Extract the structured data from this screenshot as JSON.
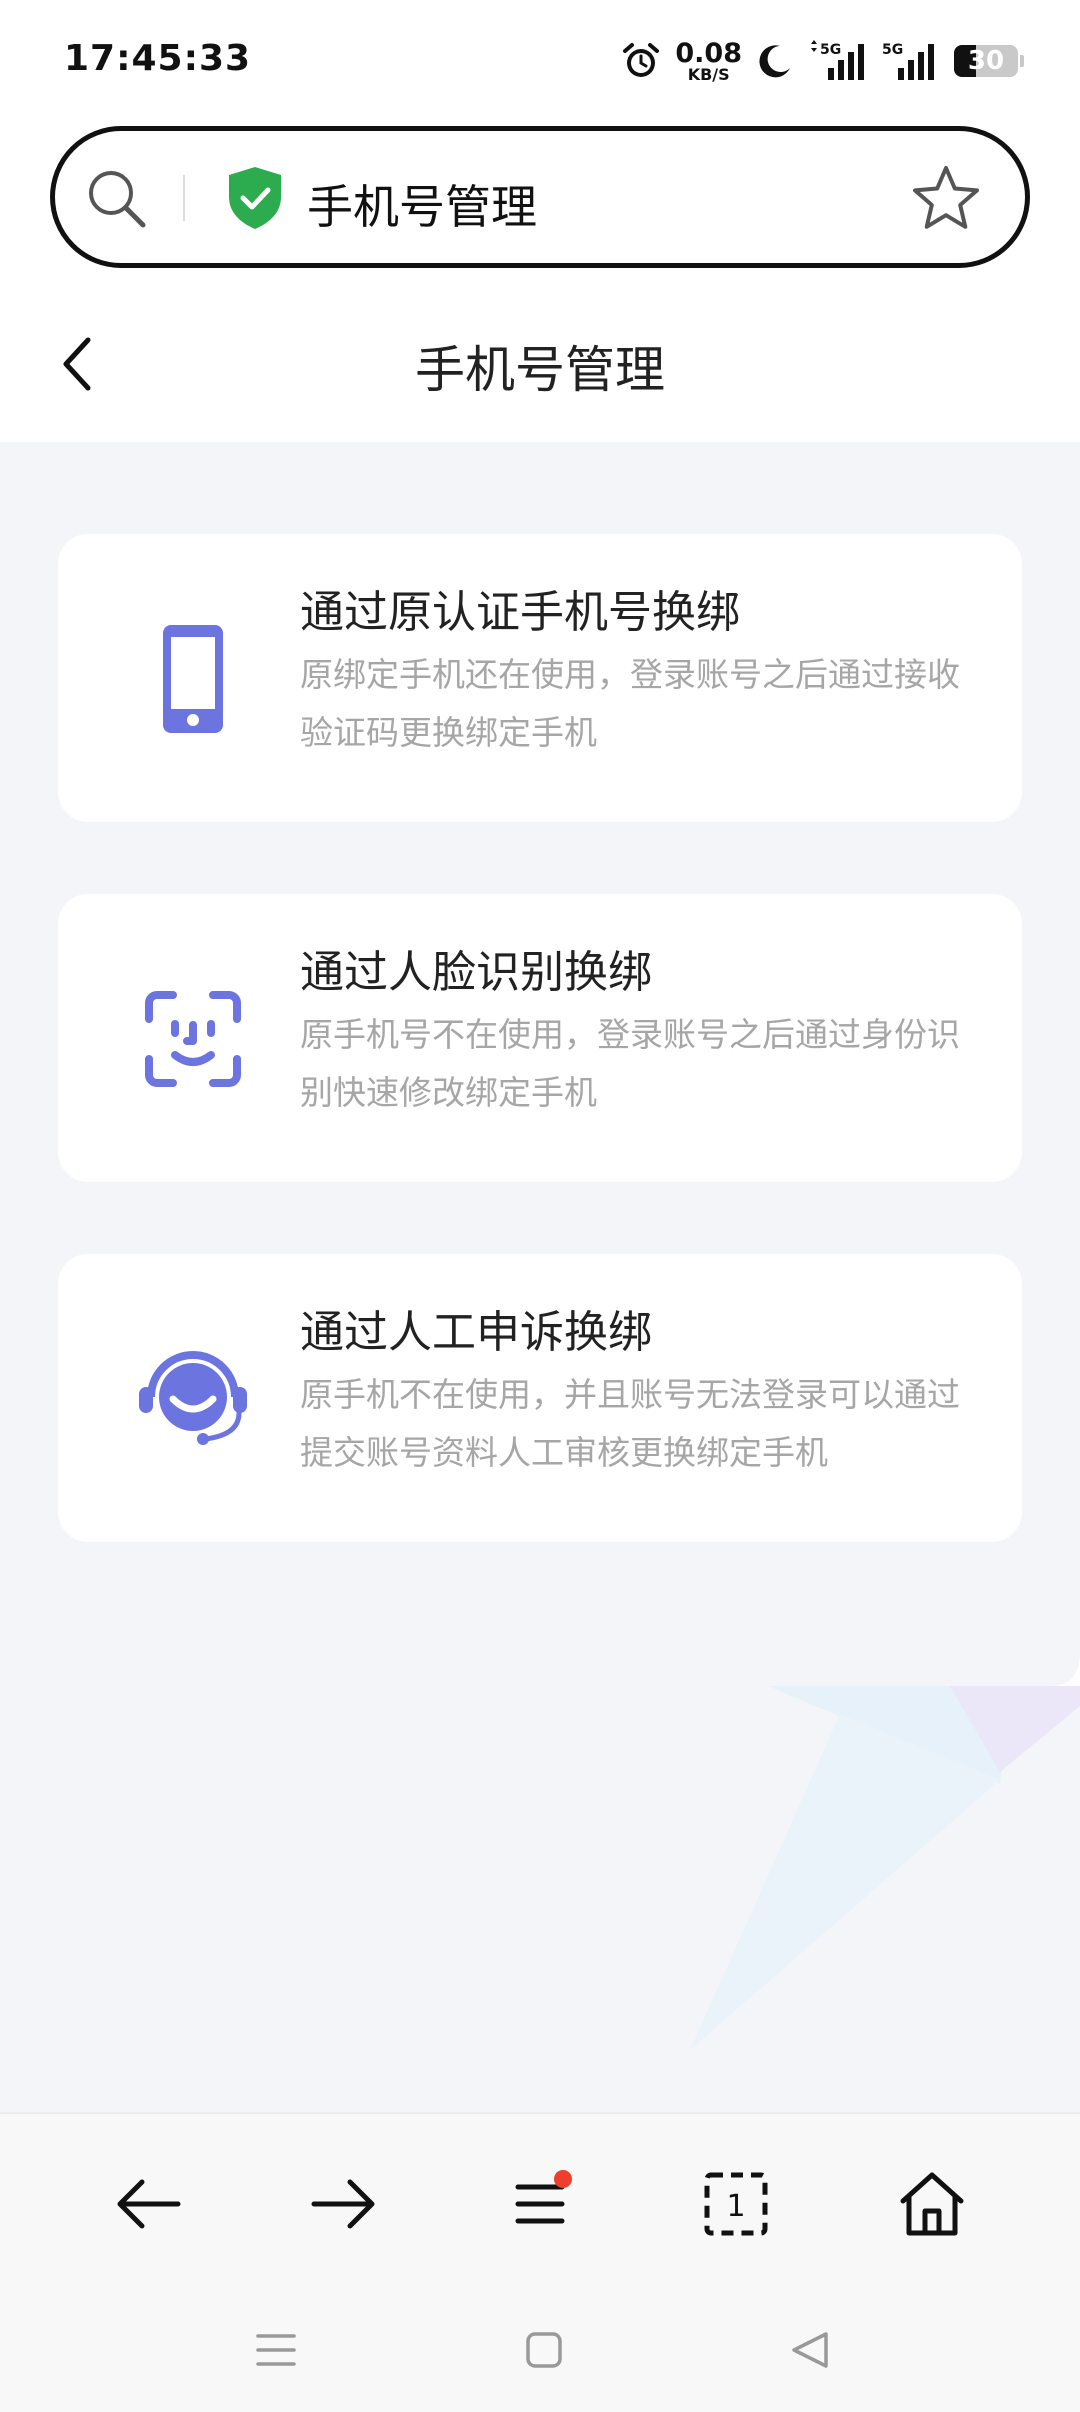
{
  "status_bar": {
    "time": "17:45:33",
    "net_speed_value": "0.08",
    "net_speed_unit": "KB/S",
    "battery_level": "30",
    "icons": [
      "alarm-icon",
      "moon-icon",
      "signal-5g-icon",
      "signal-5g-icon"
    ]
  },
  "address_bar": {
    "text": "手机号管理",
    "icons": [
      "search-icon",
      "shield-check-icon",
      "star-icon"
    ],
    "shield_color": "#2dab4f"
  },
  "header": {
    "title": "手机号管理"
  },
  "options": [
    {
      "title": "通过原认证手机号换绑",
      "description": "原绑定手机还在使用，登录账号之后通过接收验证码更换绑定手机",
      "icon": "phone-icon"
    },
    {
      "title": "通过人脸识别换绑",
      "description": "原手机号不在使用，登录账号之后通过身份识别快速修改绑定手机",
      "icon": "face-scan-icon"
    },
    {
      "title": "通过人工申诉换绑",
      "description": "原手机不在使用，并且账号无法登录可以通过提交账号资料人工审核更换绑定手机",
      "icon": "customer-service-icon"
    }
  ],
  "toolbar": {
    "tab_count": "1",
    "icons": [
      "back-arrow-icon",
      "forward-arrow-icon",
      "menu-icon",
      "tabs-icon",
      "home-icon"
    ]
  },
  "colors": {
    "accent_icon": "#6c74e0",
    "notification_dot": "#ee3f2e",
    "content_bg": "#f4f5f8"
  }
}
